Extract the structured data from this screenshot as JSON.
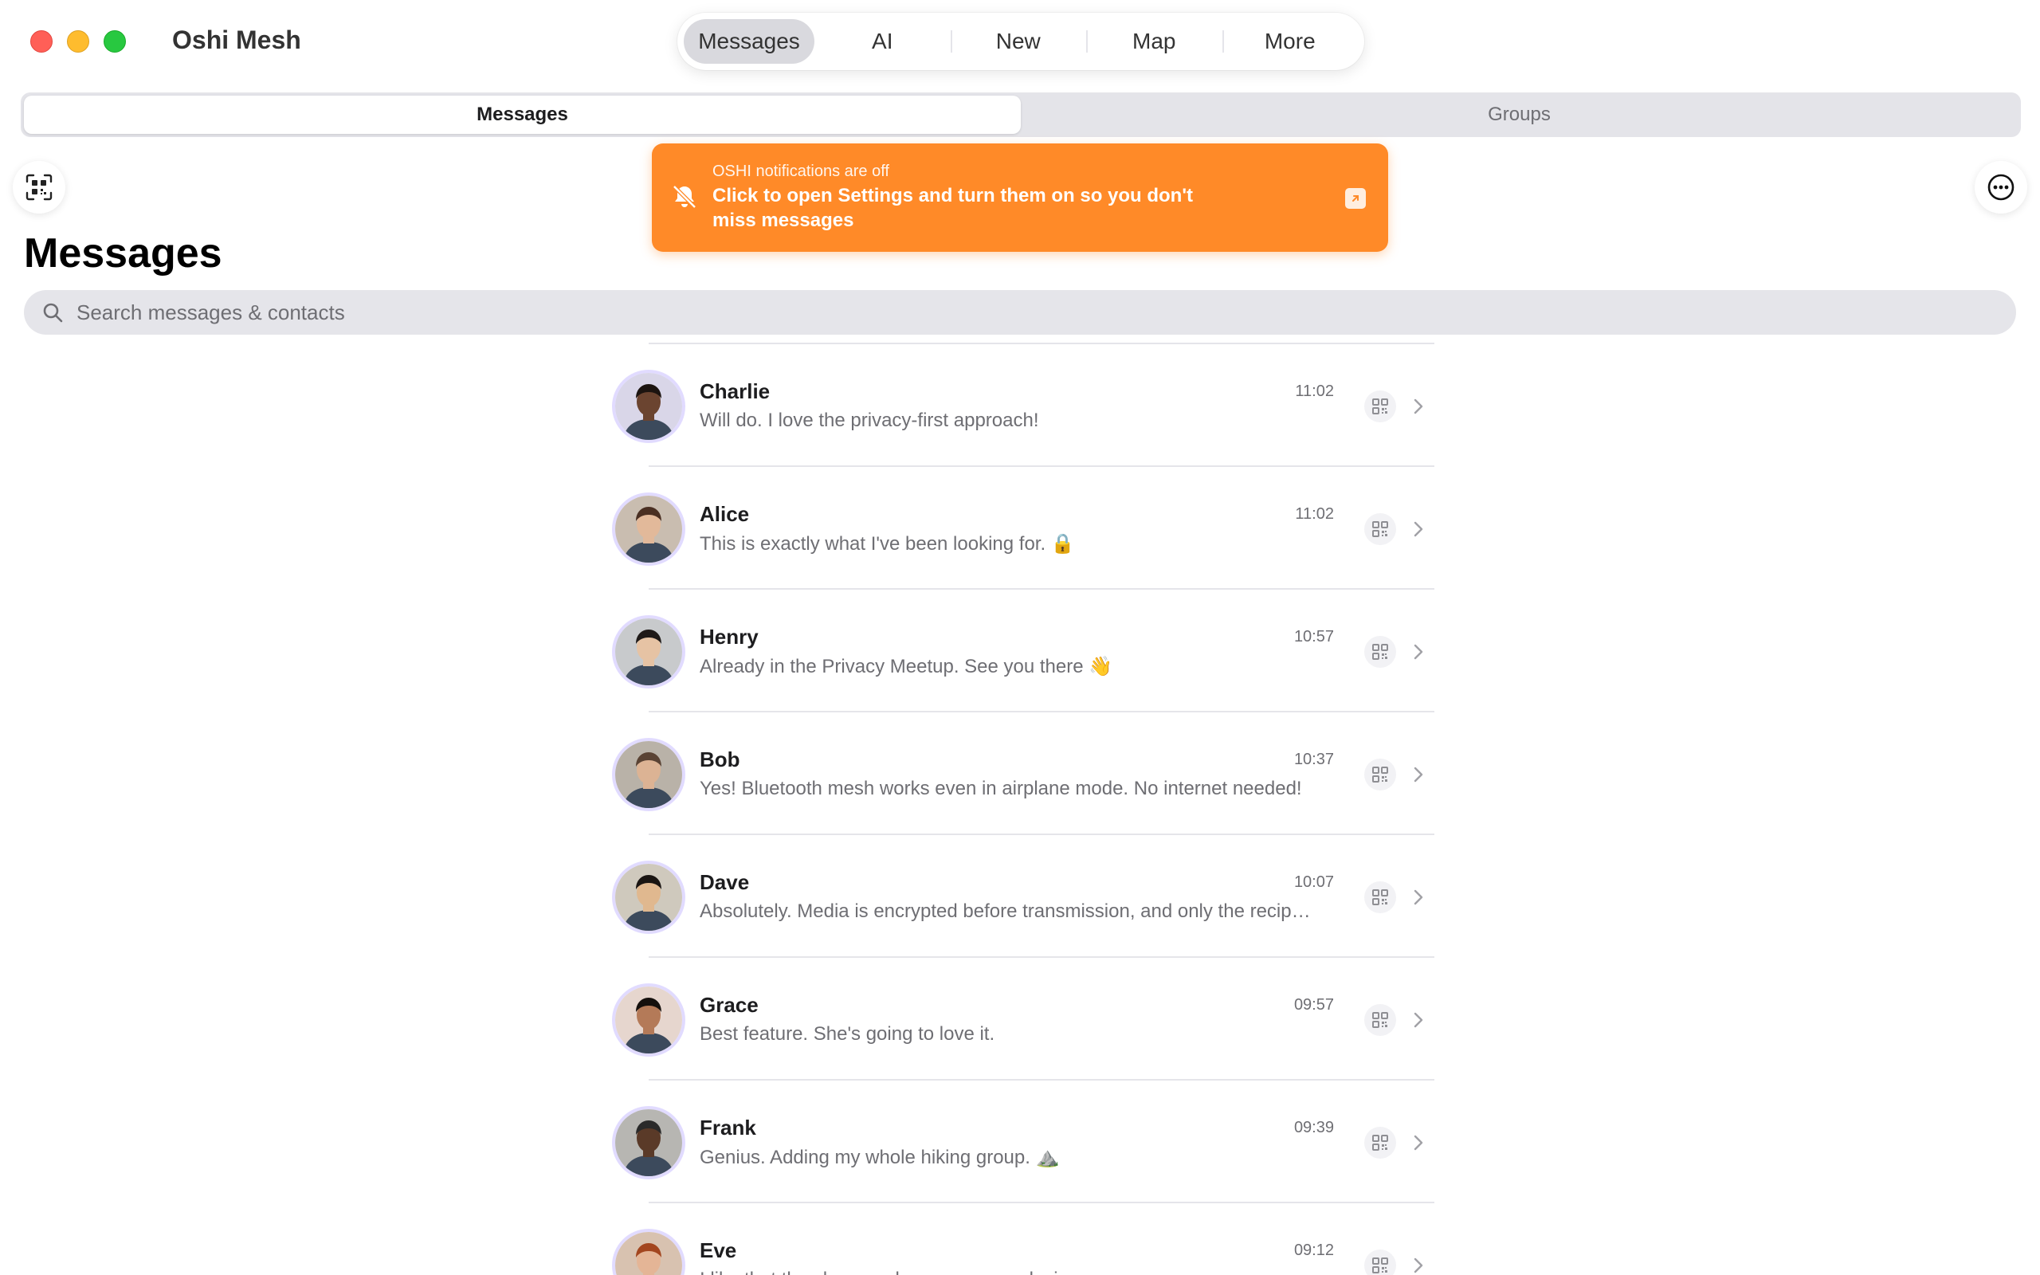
{
  "window": {
    "app_title": "Oshi Mesh"
  },
  "nav": {
    "items": [
      {
        "label": "Messages",
        "active": true
      },
      {
        "label": "AI",
        "active": false
      },
      {
        "label": "New",
        "active": false
      },
      {
        "label": "Map",
        "active": false
      },
      {
        "label": "More",
        "active": false
      }
    ]
  },
  "segments": [
    {
      "label": "Messages",
      "active": true
    },
    {
      "label": "Groups",
      "active": false
    }
  ],
  "banner": {
    "subtitle": "OSHI notifications are off",
    "message": "Click to open Settings and turn them on so you don't miss messages",
    "color": "#ff8a28"
  },
  "page": {
    "title": "Messages"
  },
  "search": {
    "placeholder": "Search messages & contacts",
    "value": ""
  },
  "conversations": [
    {
      "name": "Charlie",
      "preview": "Will do. I love the privacy-first approach!",
      "time": "11:02",
      "skin": "#6b4430",
      "hair": "#1c1410",
      "bg": "#d9d6e8"
    },
    {
      "name": "Alice",
      "preview": "This is exactly what I've been looking for. 🔒",
      "time": "11:02",
      "skin": "#e2b99a",
      "hair": "#4a2f22",
      "bg": "#c9bdb0"
    },
    {
      "name": "Henry",
      "preview": "Already in the Privacy Meetup. See you there 👋",
      "time": "10:57",
      "skin": "#e6c3a4",
      "hair": "#1f1a18",
      "bg": "#c8cacc"
    },
    {
      "name": "Bob",
      "preview": "Yes! Bluetooth mesh works even in airplane mode. No internet needed!",
      "time": "10:37",
      "skin": "#dcb394",
      "hair": "#5a4334",
      "bg": "#b9b2a8"
    },
    {
      "name": "Dave",
      "preview": "Absolutely. Media is encrypted before transmission, and only the recipient can decrypt it.",
      "time": "10:07",
      "skin": "#e0b88f",
      "hair": "#1a1512",
      "bg": "#cfc9bd"
    },
    {
      "name": "Grace",
      "preview": "Best feature. She's going to love it.",
      "time": "09:57",
      "skin": "#b47a58",
      "hair": "#15100d",
      "bg": "#e6d6ce"
    },
    {
      "name": "Frank",
      "preview": "Genius. Adding my whole hiking group. ⛰️",
      "time": "09:39",
      "skin": "#5a3a28",
      "hair": "#2a2a2a",
      "bg": "#b7b6b2"
    },
    {
      "name": "Eve",
      "preview": "I like that they have a clear, non-open design.",
      "time": "09:12",
      "skin": "#e4b596",
      "hair": "#a3461f",
      "bg": "#d8c2b0"
    }
  ]
}
